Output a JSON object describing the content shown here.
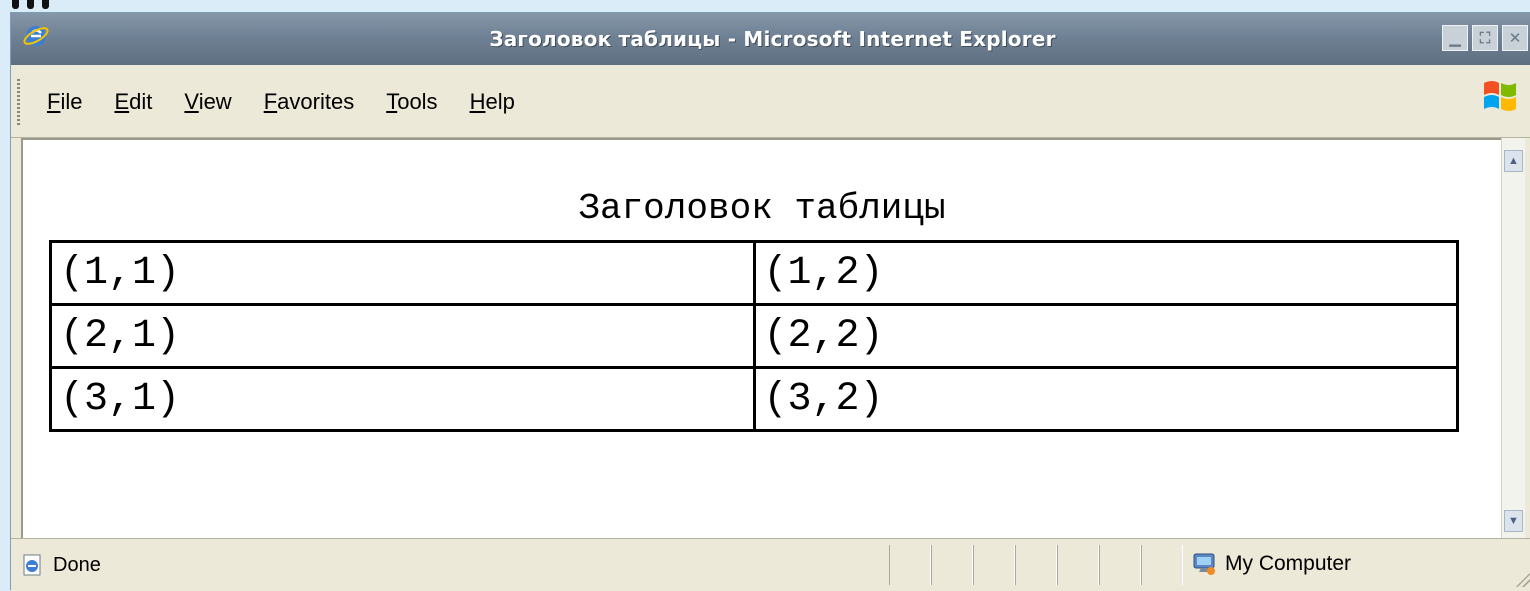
{
  "window": {
    "title": "Заголовок таблицы - Microsoft Internet Explorer",
    "buttons": [
      "minimize",
      "maximize",
      "close"
    ]
  },
  "menu": {
    "items": [
      "File",
      "Edit",
      "View",
      "Favorites",
      "Tools",
      "Help"
    ]
  },
  "page": {
    "caption": "Заголовок таблицы",
    "rows": [
      [
        "(1,1)",
        "(1,2)"
      ],
      [
        "(2,1)",
        "(2,2)"
      ],
      [
        "(3,1)",
        "(3,2)"
      ]
    ]
  },
  "status": {
    "text": "Done",
    "zone": "My Computer"
  },
  "icons": {
    "app": "ie-icon",
    "brand": "windows-flag-icon",
    "done": "page-done-icon",
    "zone": "computer-icon"
  }
}
